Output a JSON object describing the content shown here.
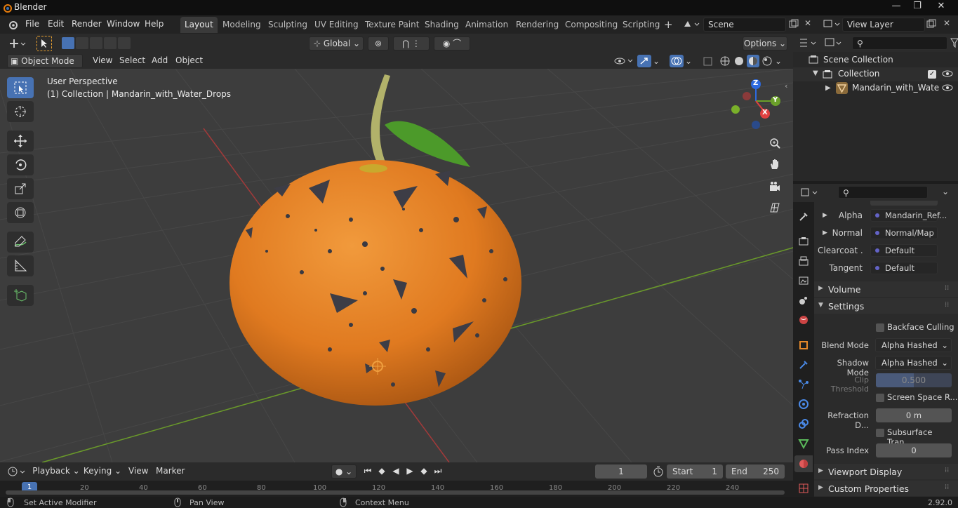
{
  "app": {
    "title": "Blender",
    "version": "2.92.0"
  },
  "menu": [
    "File",
    "Edit",
    "Render",
    "Window",
    "Help"
  ],
  "workspaces": [
    "Layout",
    "Modeling",
    "Sculpting",
    "UV Editing",
    "Texture Paint",
    "Shading",
    "Animation",
    "Rendering",
    "Compositing",
    "Scripting"
  ],
  "active_workspace": "Layout",
  "scene": {
    "name": "Scene",
    "view_layer": "View Layer"
  },
  "viewport_header": {
    "transform_orientation": "Global",
    "options_label": "Options",
    "mode": "Object Mode",
    "menus": [
      "View",
      "Select",
      "Add",
      "Object"
    ]
  },
  "viewport": {
    "perspective": "User Perspective",
    "context": "(1) Collection | Mandarin_with_Water_Drops",
    "gizmo": {
      "z": "Z",
      "y": "Y",
      "x": "X"
    }
  },
  "outliner": {
    "root": "Scene Collection",
    "collection": "Collection",
    "object": "Mandarin_with_Wate"
  },
  "properties": {
    "sockets": [
      {
        "label": "Alpha",
        "value": "Mandarin_Ref..."
      },
      {
        "label": "Normal",
        "value": "Normal/Map"
      },
      {
        "label": "Clearcoat ...",
        "value": "Default"
      },
      {
        "label": "Tangent",
        "value": "Default"
      }
    ],
    "sections": {
      "volume": "Volume",
      "settings": "Settings",
      "viewport_display": "Viewport Display",
      "custom_properties": "Custom Properties"
    },
    "settings": {
      "backface_culling": "Backface Culling",
      "blend_mode_label": "Blend Mode",
      "blend_mode": "Alpha Hashed",
      "shadow_mode_label": "Shadow Mode",
      "shadow_mode": "Alpha Hashed",
      "clip_threshold_label": "Clip Threshold",
      "clip_threshold": "0.500",
      "screen_space": "Screen Space R...",
      "refraction_label": "Refraction D...",
      "refraction": "0 m",
      "subsurface": "Subsurface Tran...",
      "pass_index_label": "Pass Index",
      "pass_index": "0"
    }
  },
  "timeline": {
    "menus": [
      "Playback",
      "Keying",
      "View",
      "Marker"
    ],
    "current_frame": "1",
    "start_label": "Start",
    "start": "1",
    "end_label": "End",
    "end": "250",
    "ruler": [
      "1",
      "20",
      "40",
      "60",
      "80",
      "100",
      "120",
      "140",
      "160",
      "180",
      "200",
      "220",
      "240"
    ]
  },
  "status": {
    "left": "Set Active Modifier",
    "middle": "Pan View",
    "right": "Context Menu"
  },
  "colors": {
    "accent": "#4772b3",
    "orange": "#e07a20",
    "grid_green": "#6a9a2a",
    "grid_red": "#a33a3a"
  }
}
